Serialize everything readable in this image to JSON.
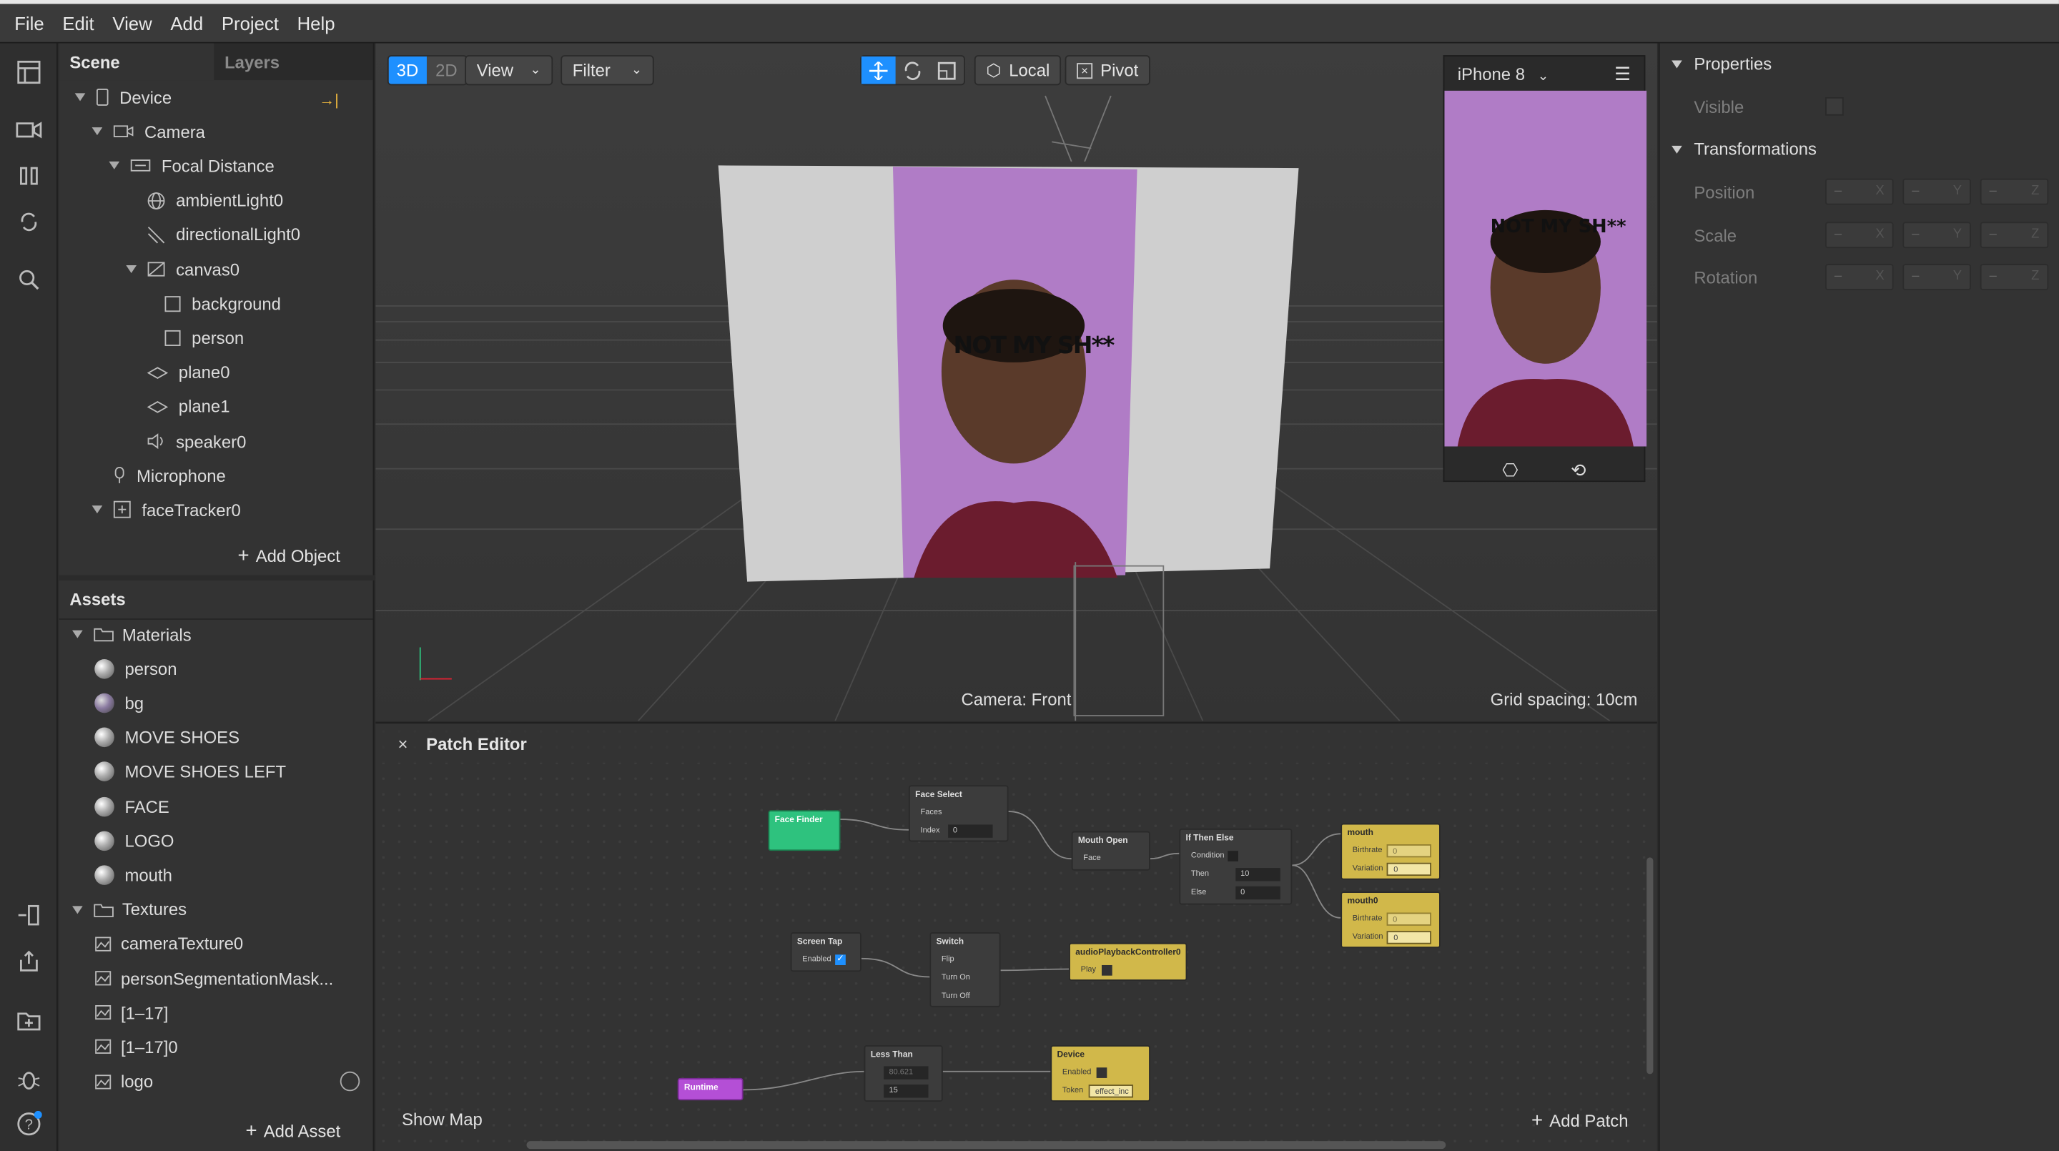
{
  "menu": [
    "File",
    "Edit",
    "View",
    "Add",
    "Project",
    "Help"
  ],
  "scene": {
    "tabs": [
      "Scene",
      "Layers"
    ],
    "items": [
      {
        "label": "Device",
        "icon": "phone-icon",
        "depth": 0,
        "expand": true
      },
      {
        "label": "Camera",
        "icon": "camera-icon",
        "depth": 1,
        "expand": true
      },
      {
        "label": "Focal Distance",
        "icon": "focal-distance-icon",
        "depth": 2,
        "expand": true
      },
      {
        "label": "ambientLight0",
        "icon": "ambient-light-icon",
        "depth": 3,
        "expand": false
      },
      {
        "label": "directionalLight0",
        "icon": "directional-light-icon",
        "depth": 3,
        "expand": false
      },
      {
        "label": "canvas0",
        "icon": "canvas-icon",
        "depth": 3,
        "expand": true
      },
      {
        "label": "background",
        "icon": "rectangle-icon",
        "depth": 4,
        "expand": false
      },
      {
        "label": "person",
        "icon": "rectangle-icon",
        "depth": 4,
        "expand": false
      },
      {
        "label": "plane0",
        "icon": "plane-icon",
        "depth": 3,
        "expand": false
      },
      {
        "label": "plane1",
        "icon": "plane-icon",
        "depth": 3,
        "expand": false
      },
      {
        "label": "speaker0",
        "icon": "speaker-icon",
        "depth": 3,
        "expand": false
      },
      {
        "label": "Microphone",
        "icon": "microphone-icon",
        "depth": 1,
        "expand": false
      },
      {
        "label": "faceTracker0",
        "icon": "face-tracker-icon",
        "depth": 1,
        "expand": true
      }
    ],
    "add_object": "Add Object"
  },
  "assets": {
    "title": "Assets",
    "items": [
      {
        "label": "Materials",
        "kind": "folder",
        "depth": 0
      },
      {
        "label": "person",
        "kind": "material",
        "depth": 1
      },
      {
        "label": "bg",
        "kind": "material",
        "depth": 1
      },
      {
        "label": "MOVE SHOES",
        "kind": "material",
        "depth": 1
      },
      {
        "label": "MOVE SHOES LEFT",
        "kind": "material",
        "depth": 1
      },
      {
        "label": "FACE",
        "kind": "material",
        "depth": 1
      },
      {
        "label": "LOGO",
        "kind": "material",
        "depth": 1
      },
      {
        "label": "mouth",
        "kind": "material",
        "depth": 1
      },
      {
        "label": "Textures",
        "kind": "folder",
        "depth": 0
      },
      {
        "label": "cameraTexture0",
        "kind": "texture",
        "depth": 1
      },
      {
        "label": "personSegmentationMask...",
        "kind": "texture",
        "depth": 1
      },
      {
        "label": "[1–17]",
        "kind": "texture",
        "depth": 1
      },
      {
        "label": "[1–17]0",
        "kind": "texture",
        "depth": 1
      },
      {
        "label": "logo",
        "kind": "texture",
        "depth": 1
      }
    ],
    "add_asset": "Add Asset"
  },
  "viewport": {
    "mode_3d": "3D",
    "mode_2d": "2D",
    "view": "View",
    "filter": "Filter",
    "local": "Local",
    "pivot": "Pivot",
    "device": "iPhone 8",
    "camera_label": "Camera: Front",
    "grid_label": "Grid spacing: 10cm",
    "overlay_text": "NOT MY SH**"
  },
  "properties": {
    "title": "Properties",
    "visible": "Visible",
    "transformations": "Transformations",
    "rows": [
      "Position",
      "Scale",
      "Rotation"
    ],
    "axes": [
      "X",
      "Y",
      "Z"
    ],
    "dash": "–"
  },
  "patch": {
    "title": "Patch Editor",
    "show_map": "Show Map",
    "add_patch": "Add Patch",
    "nodes": {
      "face_finder": "Face Finder",
      "face_select": {
        "title": "Face Select",
        "faces": "Faces",
        "index": "Index",
        "index_val": "0"
      },
      "mouth_open": {
        "title": "Mouth Open",
        "face": "Face"
      },
      "if_then_else": {
        "title": "If Then Else",
        "condition": "Condition",
        "then": "Then",
        "then_val": "10",
        "else": "Else",
        "else_val": "0"
      },
      "mouth": {
        "title": "mouth",
        "birthrate": "Birthrate",
        "birthrate_val": "0",
        "variation": "Variation",
        "variation_val": "0"
      },
      "mouth0": {
        "title": "mouth0",
        "birthrate": "Birthrate",
        "birthrate_val": "0",
        "variation": "Variation",
        "variation_val": "0"
      },
      "screen_tap": {
        "title": "Screen Tap",
        "enabled": "Enabled"
      },
      "switch": {
        "title": "Switch",
        "flip": "Flip",
        "turn_on": "Turn On",
        "turn_off": "Turn Off"
      },
      "audio": {
        "title": "audioPlaybackController0",
        "play": "Play"
      },
      "runtime": "Runtime",
      "less_than": {
        "title": "Less Than",
        "a_val": "80.621",
        "b_val": "15"
      },
      "device": {
        "title": "Device",
        "enabled": "Enabled",
        "token": "Token",
        "token_val": "effect_inc"
      }
    }
  },
  "colors": {
    "accent": "#1e90ff",
    "patch_green": "#2ec27e",
    "patch_yellow": "#d1b84a",
    "patch_purple": "#b44fd6",
    "canvas_purple": "#b07cc6"
  }
}
